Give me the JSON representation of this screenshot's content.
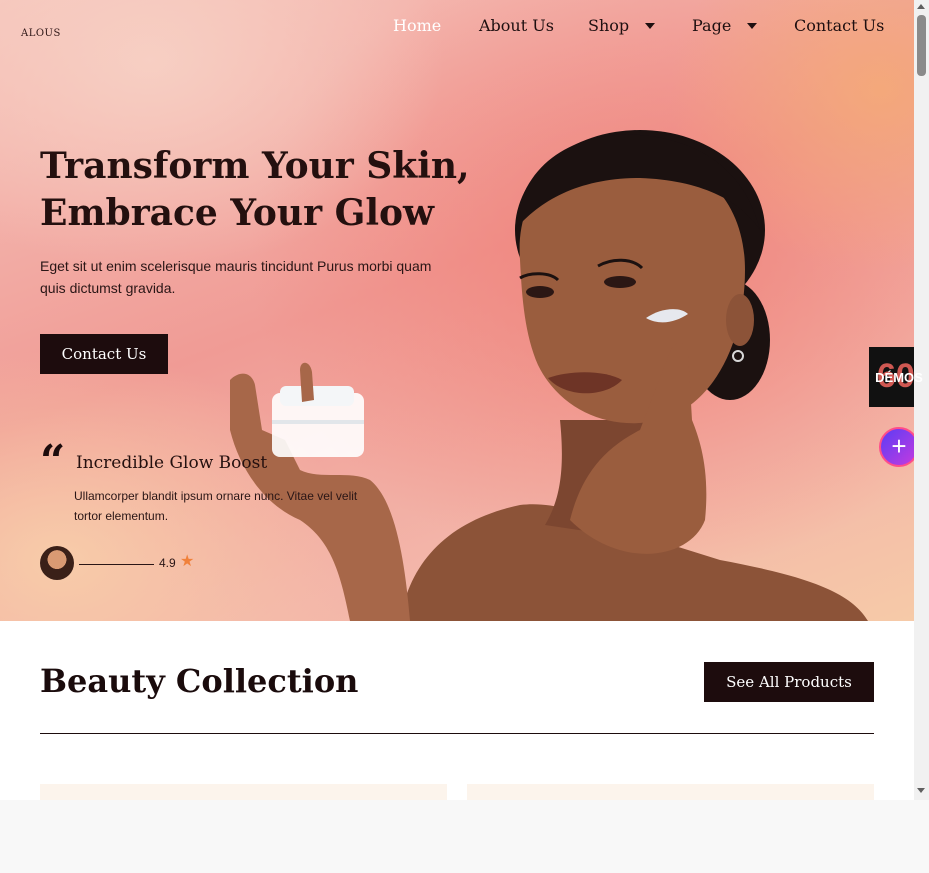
{
  "brand": {
    "logo": "ALOUS"
  },
  "nav": {
    "items": [
      {
        "label": "Home",
        "active": true,
        "has_dropdown": false
      },
      {
        "label": "About Us",
        "active": false,
        "has_dropdown": false
      },
      {
        "label": "Shop",
        "active": false,
        "has_dropdown": true
      },
      {
        "label": "Page",
        "active": false,
        "has_dropdown": true
      },
      {
        "label": "Contact Us",
        "active": false,
        "has_dropdown": false
      }
    ]
  },
  "hero": {
    "title_line1": "Transform Your Skin,",
    "title_line2": "Embrace Your Glow",
    "description": "Eget sit ut enim scelerisque mauris tincidunt Purus morbi quam quis dictumst gravida.",
    "cta_label": "Contact Us",
    "quote_icon": "quote-icon",
    "testimonial": {
      "title": "Incredible Glow Boost",
      "text": "Ullamcorper blandit ipsum ornare nunc. Vitae vel velit tortor elementum.",
      "rating": "4.9",
      "rating_icon": "star-icon"
    }
  },
  "widgets": {
    "demos_label": "DÉMOS",
    "demos_badge": "60",
    "plus_icon": "+"
  },
  "collection": {
    "title": "Beauty Collection",
    "button_label": "See All Products"
  },
  "colors": {
    "dark": "#1d0c0d",
    "accent_star": "#f0813a",
    "hero_pink": "#f09b95",
    "card_bg": "#fcf4ec"
  }
}
